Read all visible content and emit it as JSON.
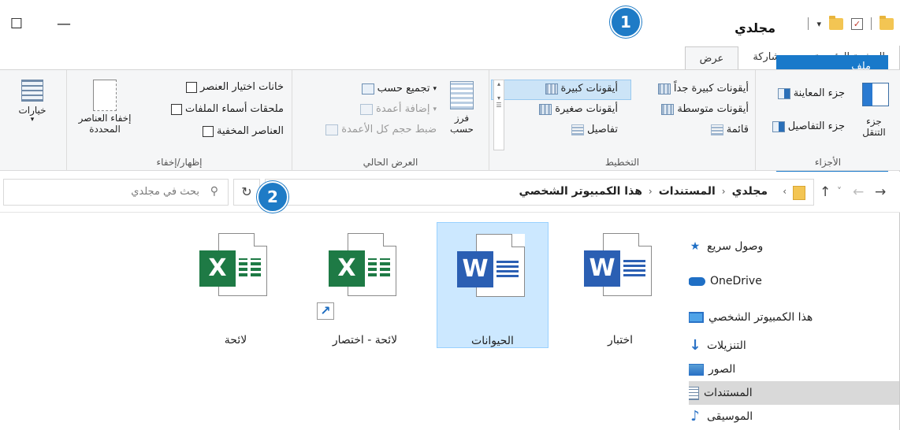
{
  "window": {
    "title": "مجلدي",
    "maximize_glyph": "☐",
    "minimize_glyph": "—"
  },
  "qat": {
    "check_glyph": "✓",
    "dropdown_glyph": "▾"
  },
  "tabs": [
    {
      "label": "ملف"
    },
    {
      "label": "الصفحة الرئيسية"
    },
    {
      "label": "مشاركة"
    },
    {
      "label": "عرض"
    }
  ],
  "badges": [
    "1",
    "2"
  ],
  "ribbon": {
    "panes": {
      "label": "الأجزاء",
      "nav_pane": "جزء التنقل",
      "preview": "جزء المعاينة",
      "details": "جزء التفاصيل"
    },
    "layout": {
      "label": "التخطيط",
      "extra_large": "أيقونات كبيرة جداً",
      "large": "أيقونات كبيرة",
      "medium": "أيقونات متوسطة",
      "small": "أيقونات صغيرة",
      "list": "قائمة",
      "details": "تفاصيل"
    },
    "current_view": {
      "label": "العرض الحالي",
      "sort_by": "فرز حسب",
      "group_by": "تجميع حسب",
      "add_columns": "إضافة أعمدة",
      "size_columns": "ضبط حجم كل الأعمدة"
    },
    "show_hide": {
      "label": "إظهار/إخفاء",
      "item_checkboxes": "خانات اختيار العنصر",
      "extensions": "ملحقات أسماء الملفات",
      "hidden_items": "العناصر المخفية",
      "hide_selected": "إخفاء العناصر المحددة"
    },
    "options": "خيارات"
  },
  "address": {
    "crumbs": [
      "هذا الكمبيوتر الشخصي",
      "المستندات",
      "مجلدي"
    ],
    "search_placeholder": "بحث في مجلدي",
    "refresh_glyph": "↻",
    "search_glyph": "⚲"
  },
  "nav": {
    "back": "←",
    "forward": "→",
    "recent": "˅",
    "up": "↑",
    "items": [
      {
        "label": "وصول سريع",
        "icon": "star-icon"
      },
      {
        "label": "OneDrive",
        "icon": "cloud-icon"
      },
      {
        "label": "هذا الكمبيوتر الشخصي",
        "icon": "computer-icon"
      },
      {
        "label": "التنزيلات",
        "icon": "download-icon"
      },
      {
        "label": "الصور",
        "icon": "pictures-icon"
      },
      {
        "label": "المستندات",
        "icon": "documents-icon",
        "selected": true
      },
      {
        "label": "الموسيقى",
        "icon": "music-icon"
      }
    ]
  },
  "files": [
    {
      "name": "اختبار",
      "type": "word"
    },
    {
      "name": "الحيوانات",
      "type": "word",
      "selected": true
    },
    {
      "name": "لائحة - اختصار",
      "type": "excel",
      "shortcut": true
    },
    {
      "name": "لائحة",
      "type": "excel"
    }
  ],
  "app_letters": {
    "word": "W",
    "excel": "X"
  }
}
